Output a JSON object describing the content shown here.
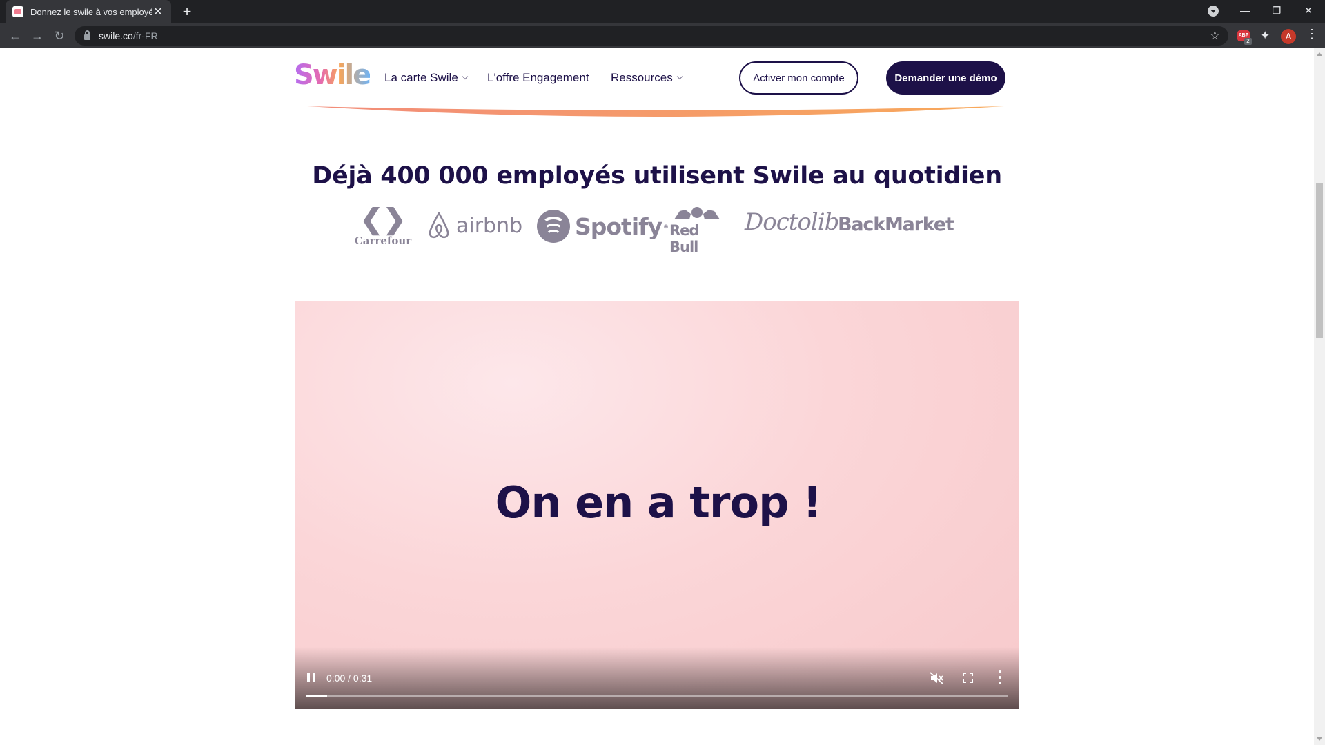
{
  "browser": {
    "tab_title": "Donnez le swile à vos employés",
    "url_host": "swile.co",
    "url_path": "/fr-FR",
    "extension_badge": "2",
    "extension_label": "ABP",
    "profile_initial": "A"
  },
  "header": {
    "logo": "Swile",
    "nav": [
      {
        "label": "La carte Swile",
        "has_dropdown": true
      },
      {
        "label": "L'offre Engagement",
        "has_dropdown": false
      },
      {
        "label": "Ressources",
        "has_dropdown": true
      }
    ],
    "activate_button": "Activer mon compte",
    "demo_button": "Demander une démo"
  },
  "trust": {
    "headline": "Déjà 400 000 employés utilisent Swile au quotidien",
    "logos": {
      "carrefour": "Carrefour",
      "airbnb": "airbnb",
      "spotify": "Spotify",
      "redbull": "Red Bull",
      "doctolib": "Doctolib",
      "backmarket": "BackMarket"
    }
  },
  "video": {
    "caption": "On en a trop !",
    "time": "0:00 / 0:31",
    "progress_fraction": 0.03,
    "muted": true
  },
  "colors": {
    "brand_navy": "#1d1148",
    "logo_gray": "#8a8497",
    "video_bg": "#f9d3d6",
    "swoosh_start": "#f28c7a",
    "swoosh_end": "#f8a95a"
  }
}
